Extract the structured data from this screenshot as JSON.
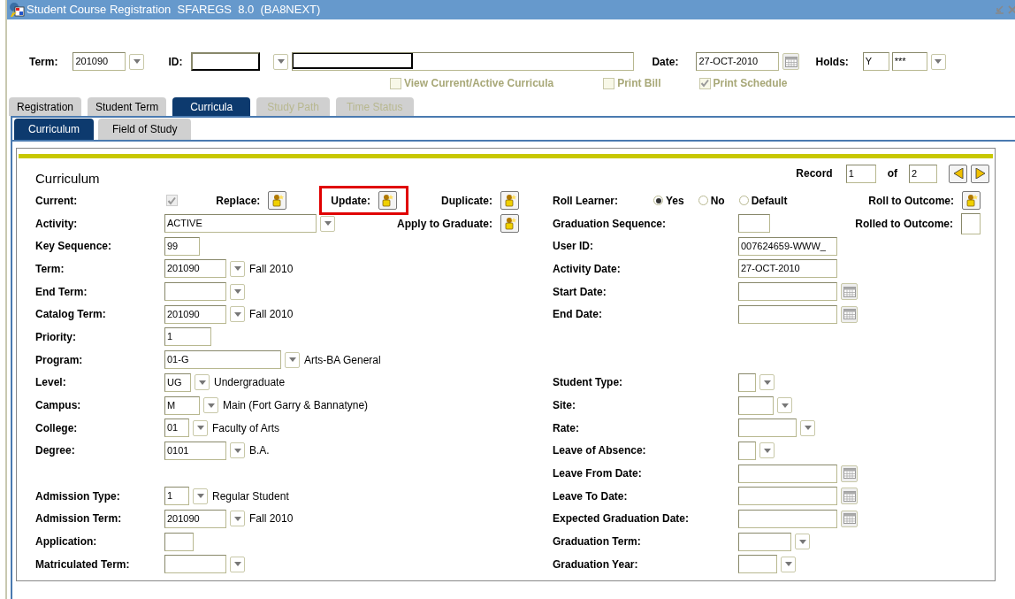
{
  "window": {
    "title": "Student Course Registration  SFAREGS  8.0  (BA8NEXT)"
  },
  "header": {
    "term": {
      "label": "Term:",
      "value": "201090"
    },
    "id": {
      "label": "ID:"
    },
    "date": {
      "label": "Date:",
      "value": "27-OCT-2010"
    },
    "holds": {
      "label": "Holds:",
      "value": "Y",
      "value_2": "***"
    }
  },
  "options": [
    {
      "label": "View Current/Active Curricula",
      "checked": false
    },
    {
      "label": "Print Bill",
      "checked": false
    },
    {
      "label": "Print Schedule",
      "checked": true
    }
  ],
  "tabs": [
    {
      "label": "Registration",
      "selected": false,
      "disabled": false
    },
    {
      "label": "Student Term",
      "selected": false,
      "disabled": false
    },
    {
      "label": "Curricula",
      "selected": true,
      "disabled": false
    },
    {
      "label": "Study Path",
      "selected": false,
      "disabled": true
    },
    {
      "label": "Time Status",
      "selected": false,
      "disabled": true
    }
  ],
  "subtabs": [
    {
      "label": "Curriculum",
      "selected": true
    },
    {
      "label": "Field of Study",
      "selected": false
    }
  ],
  "section": {
    "title": "Curriculum",
    "record": {
      "label": "Record",
      "current": "1",
      "of": "of",
      "total": "2"
    }
  },
  "left_fields": [
    {
      "label": "Current:",
      "kind": "check",
      "checked": true,
      "actions": [
        {
          "label": "Replace:",
          "kind": "button",
          "highlighted": false
        },
        {
          "label": "Update:",
          "kind": "button",
          "highlighted": true
        },
        {
          "label": "Duplicate:",
          "kind": "button",
          "highlighted": false
        }
      ]
    },
    {
      "label": "Activity:",
      "kind": "lov",
      "value": "ACTIVE",
      "actions": [
        {
          "label": "Apply to Graduate:",
          "kind": "button",
          "highlighted": false
        }
      ]
    },
    {
      "label": "Key Sequence:",
      "kind": "text",
      "value": "99"
    },
    {
      "label": "Term:",
      "kind": "lov",
      "value": "201090",
      "description": "Fall 2010"
    },
    {
      "label": "End Term:",
      "kind": "lov"
    },
    {
      "label": "Catalog Term:",
      "kind": "lov",
      "value": "201090",
      "description": "Fall 2010"
    },
    {
      "label": "Priority:",
      "kind": "text",
      "value": "1"
    },
    {
      "label": "Program:",
      "kind": "lov",
      "value": "01-G",
      "description": "Arts-BA General"
    },
    {
      "label": "Level:",
      "kind": "lov",
      "value": "UG",
      "description": "Undergraduate"
    },
    {
      "label": "Campus:",
      "kind": "lov",
      "value": "M",
      "description": "Main (Fort Garry & Bannatyne)"
    },
    {
      "label": "College:",
      "kind": "lov",
      "value": "01",
      "description": "Faculty of Arts"
    },
    {
      "label": "Degree:",
      "kind": "lov",
      "value": "0101",
      "description": "B.A."
    },
    {
      "label": "Admission Type:",
      "kind": "lov",
      "value": "1",
      "description": "Regular Student"
    },
    {
      "label": "Admission Term:",
      "kind": "lov",
      "value": "201090",
      "description": "Fall 2010"
    },
    {
      "label": "Application:",
      "kind": "text"
    },
    {
      "label": "Matriculated Term:",
      "kind": "lov"
    }
  ],
  "right_fields": [
    {
      "label": "Roll Learner:",
      "kind": "radio",
      "options": [
        {
          "label": "Yes",
          "selected": true
        },
        {
          "label": "No",
          "selected": false
        },
        {
          "label": "Default",
          "selected": false
        }
      ],
      "actions": [
        {
          "label": "Roll to Outcome:",
          "kind": "button",
          "highlighted": false
        }
      ]
    },
    {
      "label": "Graduation Sequence:",
      "kind": "text",
      "actions": [
        {
          "label": "Rolled to Outcome:",
          "kind": "box",
          "highlighted": false
        }
      ]
    },
    {
      "label": "User ID:",
      "kind": "text",
      "value": "007624659-WWW_"
    },
    {
      "label": "Activity Date:",
      "kind": "text",
      "value": "27-OCT-2010"
    },
    {
      "label": "Start Date:",
      "kind": "date"
    },
    {
      "label": "End Date:",
      "kind": "date"
    },
    {
      "label": "Student Type:",
      "kind": "lov"
    },
    {
      "label": "Site:",
      "kind": "lov"
    },
    {
      "label": "Rate:",
      "kind": "lov"
    },
    {
      "label": "Leave of Absence:",
      "kind": "lov"
    },
    {
      "label": "Leave From Date:",
      "kind": "date"
    },
    {
      "label": "Leave To Date:",
      "kind": "date"
    },
    {
      "label": "Expected Graduation Date:",
      "kind": "date"
    },
    {
      "label": "Graduation Term:",
      "kind": "lov"
    },
    {
      "label": "Graduation Year:",
      "kind": "lov"
    }
  ]
}
